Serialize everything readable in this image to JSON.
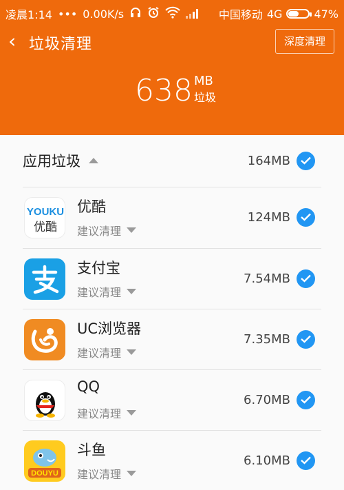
{
  "status_bar": {
    "time": "凌晨1:14",
    "dots": "•••",
    "net_speed": "0.00K/s",
    "carrier": "中国移动",
    "network": "4G",
    "battery_pct": "47%",
    "battery_level": 0.47
  },
  "header": {
    "back_glyph": "‹",
    "title": "垃圾清理",
    "deep_clean_button": "深度清理",
    "total_size": "638",
    "total_unit": "MB",
    "total_label": "垃圾"
  },
  "section": {
    "title": "应用垃圾",
    "size": "164MB",
    "checked": true
  },
  "apps": [
    {
      "name": "优酷",
      "sub": "建议清理",
      "size": "124MB",
      "icon": "youku-icon"
    },
    {
      "name": "支付宝",
      "sub": "建议清理",
      "size": "7.54MB",
      "icon": "alipay-icon"
    },
    {
      "name": "UC浏览器",
      "sub": "建议清理",
      "size": "7.35MB",
      "icon": "uc-browser-icon"
    },
    {
      "name": "QQ",
      "sub": "建议清理",
      "size": "6.70MB",
      "icon": "qq-icon"
    },
    {
      "name": "斗鱼",
      "sub": "建议清理",
      "size": "6.10MB",
      "icon": "douyu-icon"
    }
  ],
  "icon_text": {
    "youku_top": "YOUKU",
    "youku_bottom": "优酷",
    "douyu": "DOUYU"
  },
  "colors": {
    "header_bg": "#ef6a0c",
    "check_blue": "#2196f3"
  }
}
